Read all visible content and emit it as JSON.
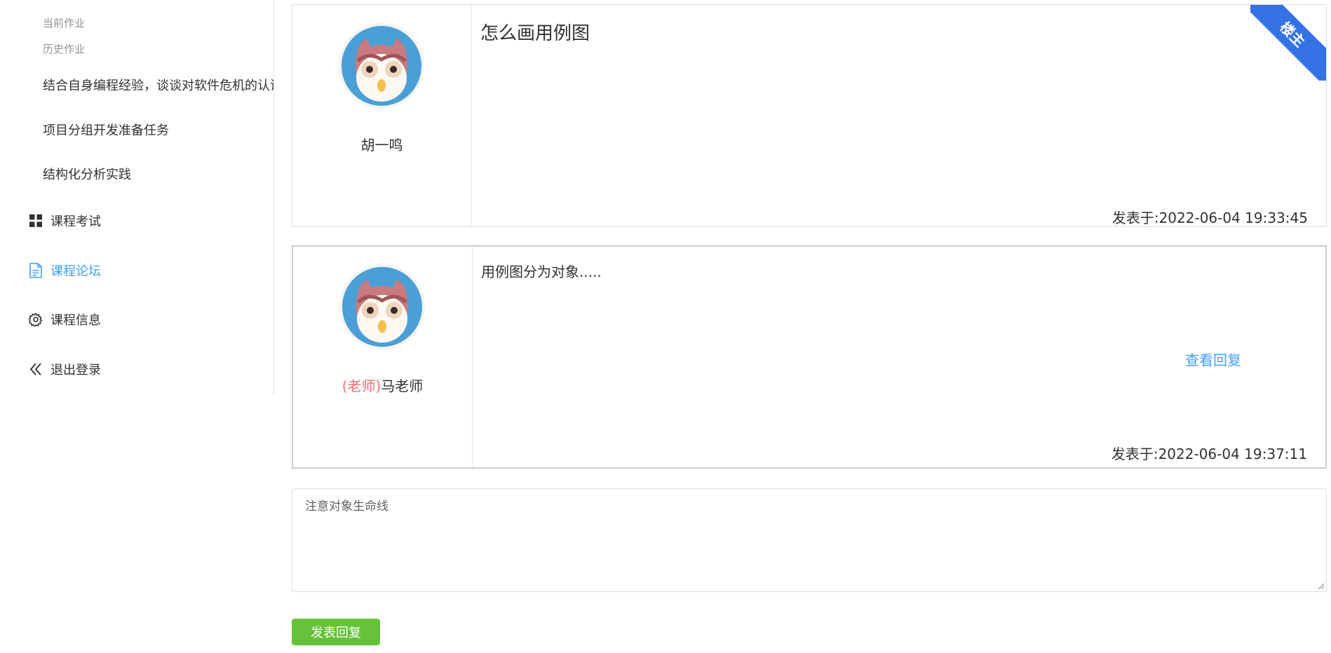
{
  "sidebar": {
    "sub_labels": [
      "当前作业",
      "历史作业"
    ],
    "homework_items": [
      "结合自身编程经验，谈谈对软件危机的认识",
      "项目分组开发准备任务",
      "结构化分析实践"
    ],
    "menu": [
      {
        "label": "课程考试",
        "icon": "grid-icon",
        "active": false
      },
      {
        "label": "课程论坛",
        "icon": "document-icon",
        "active": true
      },
      {
        "label": "课程信息",
        "icon": "gear-icon",
        "active": false
      },
      {
        "label": "退出登录",
        "icon": "double-chevron-left-icon",
        "active": false
      }
    ],
    "active_color": "#409eff"
  },
  "posts": [
    {
      "author": "胡一鸣",
      "title": "怎么画用例图",
      "time": "发表于:2022-06-04 19:33:45",
      "ribbon": "楼主",
      "ribbon_color": "#3572e3"
    },
    {
      "author_tag": "(老师)",
      "author": "马老师",
      "body": "用例图分为对象.....",
      "view_reply": "查看回复",
      "time": "发表于:2022-06-04 19:37:11"
    }
  ],
  "reply": {
    "value": "注意对象生命线",
    "submit_label": "发表回复",
    "submit_color": "#67c23a"
  }
}
